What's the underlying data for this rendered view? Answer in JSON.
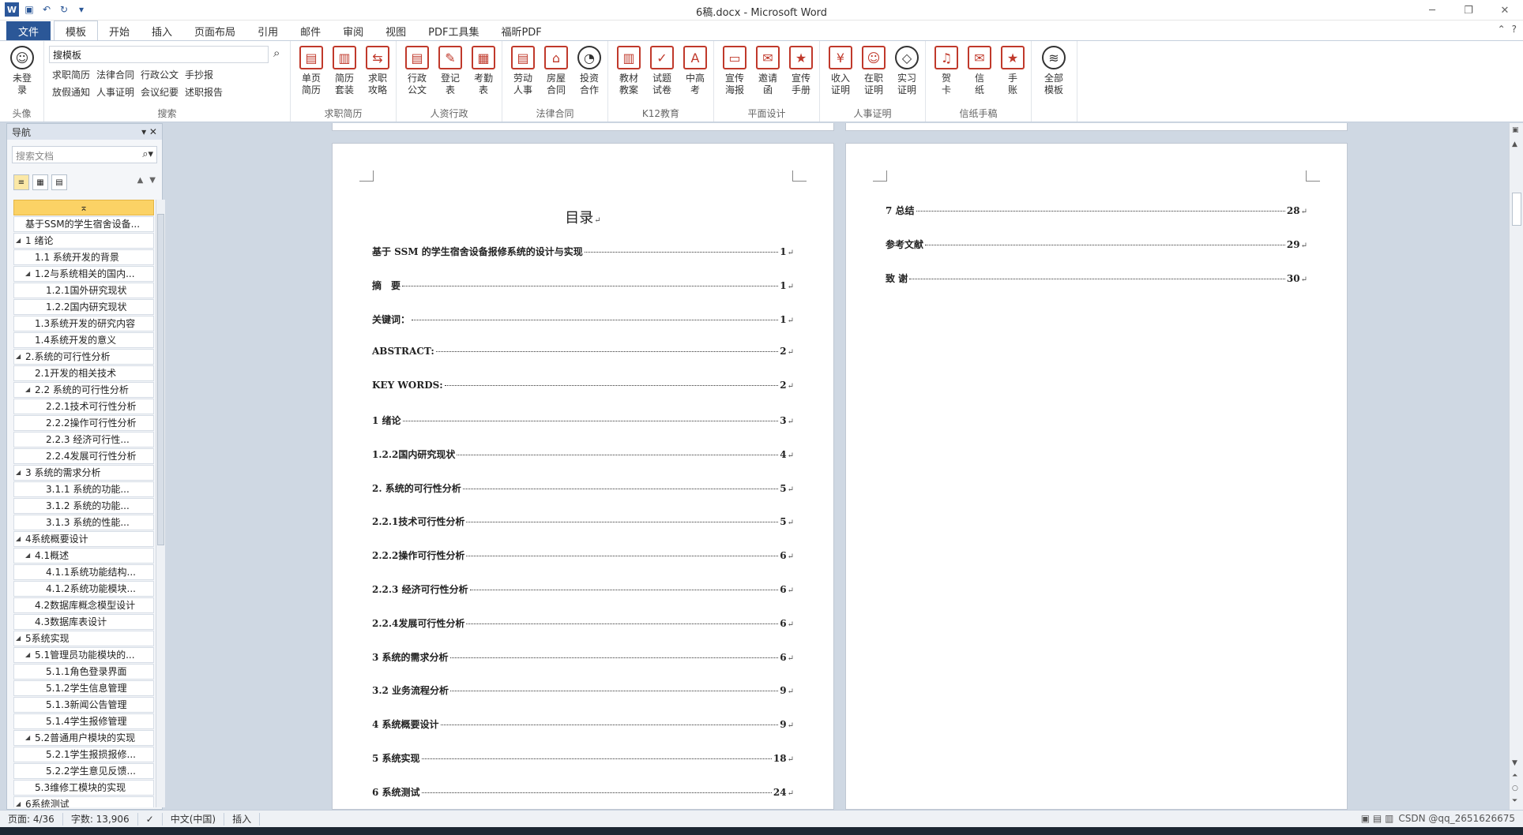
{
  "window": {
    "title": "6稿.docx - Microsoft Word"
  },
  "tabs": [
    {
      "label": "文件"
    },
    {
      "label": "模板"
    },
    {
      "label": "开始"
    },
    {
      "label": "插入"
    },
    {
      "label": "页面布局"
    },
    {
      "label": "引用"
    },
    {
      "label": "邮件"
    },
    {
      "label": "审阅"
    },
    {
      "label": "视图"
    },
    {
      "label": "PDF工具集"
    },
    {
      "label": "福昕PDF"
    }
  ],
  "ribbon": {
    "avatar": {
      "label1": "未登",
      "label2": "录",
      "group": "头像"
    },
    "search": {
      "value": "搜模板",
      "links_row1": [
        "求职简历",
        "法律合同",
        "行政公文",
        "手抄报"
      ],
      "links_row2": [
        "放假通知",
        "人事证明",
        "会议纪要",
        "述职报告"
      ],
      "group": "搜索"
    },
    "groups": [
      {
        "label": "求职简历",
        "buttons": [
          [
            "单页",
            "简历"
          ],
          [
            "简历",
            "套装"
          ],
          [
            "求职",
            "攻略"
          ]
        ]
      },
      {
        "label": "人资行政",
        "buttons": [
          [
            "行政",
            "公文"
          ],
          [
            "登记",
            "表"
          ],
          [
            "考勤",
            "表"
          ]
        ]
      },
      {
        "label": "法律合同",
        "buttons": [
          [
            "劳动",
            "人事"
          ],
          [
            "房屋",
            "合同"
          ],
          [
            "投资",
            "合作"
          ]
        ]
      },
      {
        "label": "K12教育",
        "buttons": [
          [
            "教材",
            "教案"
          ],
          [
            "试题",
            "试卷"
          ],
          [
            "中高",
            "考"
          ]
        ]
      },
      {
        "label": "平面设计",
        "buttons": [
          [
            "宣传",
            "海报"
          ],
          [
            "邀请",
            "函"
          ],
          [
            "宣传",
            "手册"
          ]
        ]
      },
      {
        "label": "人事证明",
        "buttons": [
          [
            "收入",
            "证明"
          ],
          [
            "在职",
            "证明"
          ],
          [
            "实习",
            "证明"
          ]
        ]
      },
      {
        "label": "信纸手稿",
        "buttons": [
          [
            "贺",
            "卡"
          ],
          [
            "信",
            "纸"
          ],
          [
            "手",
            "账"
          ]
        ]
      },
      {
        "label": "",
        "buttons": [
          [
            "全部",
            "模板"
          ]
        ]
      }
    ]
  },
  "nav": {
    "title": "导航",
    "search_placeholder": "搜索文档",
    "items": [
      {
        "text": "基于SSM的学生宿舍设备...",
        "level": 0
      },
      {
        "text": "1 绪论",
        "level": 0,
        "expanded": true
      },
      {
        "text": "1.1 系统开发的背景",
        "level": 1
      },
      {
        "text": "1.2与系统相关的国内...",
        "level": 1,
        "expanded": true
      },
      {
        "text": "1.2.1国外研究现状",
        "level": 2
      },
      {
        "text": "1.2.2国内研究现状",
        "level": 2
      },
      {
        "text": "1.3系统开发的研究内容",
        "level": 1
      },
      {
        "text": "1.4系统开发的意义",
        "level": 1
      },
      {
        "text": "2.系统的可行性分析",
        "level": 0,
        "expanded": true
      },
      {
        "text": "2.1开发的相关技术",
        "level": 1
      },
      {
        "text": "2.2 系统的可行性分析",
        "level": 1,
        "expanded": true
      },
      {
        "text": "2.2.1技术可行性分析",
        "level": 2
      },
      {
        "text": "2.2.2操作可行性分析",
        "level": 2
      },
      {
        "text": "2.2.3 经济可行性...",
        "level": 2
      },
      {
        "text": "2.2.4发展可行性分析",
        "level": 2
      },
      {
        "text": "3 系统的需求分析",
        "level": 0,
        "expanded": true
      },
      {
        "text": "3.1.1 系统的功能...",
        "level": 2
      },
      {
        "text": "3.1.2 系统的功能...",
        "level": 2
      },
      {
        "text": "3.1.3 系统的性能...",
        "level": 2
      },
      {
        "text": "4系统概要设计",
        "level": 0,
        "expanded": true
      },
      {
        "text": "4.1概述",
        "level": 1,
        "expanded": true
      },
      {
        "text": "4.1.1系统功能结构...",
        "level": 2
      },
      {
        "text": "4.1.2系统功能模块...",
        "level": 2
      },
      {
        "text": "4.2数据库概念模型设计",
        "level": 1
      },
      {
        "text": "4.3数据库表设计",
        "level": 1
      },
      {
        "text": "5系统实现",
        "level": 0,
        "expanded": true
      },
      {
        "text": "5.1管理员功能模块的...",
        "level": 1,
        "expanded": true
      },
      {
        "text": "5.1.1角色登录界面",
        "level": 2
      },
      {
        "text": "5.1.2学生信息管理",
        "level": 2
      },
      {
        "text": "5.1.3新闻公告管理",
        "level": 2
      },
      {
        "text": "5.1.4学生报修管理",
        "level": 2
      },
      {
        "text": "5.2普通用户模块的实现",
        "level": 1,
        "expanded": true
      },
      {
        "text": "5.2.1学生报损报修...",
        "level": 2
      },
      {
        "text": "5.2.2学生意见反馈...",
        "level": 2
      },
      {
        "text": "5.3维修工模块的实现",
        "level": 1
      },
      {
        "text": "6系统测试",
        "level": 0,
        "expanded": true
      }
    ]
  },
  "page1": {
    "heading": "目录",
    "entries": [
      {
        "label": "基于 SSM 的学生宿舍设备报修系统的设计与实现",
        "page": "1"
      },
      {
        "label": "摘　要",
        "page": "1"
      },
      {
        "label": "关键词：",
        "page": "1"
      },
      {
        "label": "ABSTRACT:",
        "page": "2"
      },
      {
        "label": "KEY WORDS:",
        "page": "2"
      },
      {
        "label": "1  绪论",
        "page": "3"
      },
      {
        "label": "1.2.2国内研究现状",
        "page": "4"
      },
      {
        "label": "2. 系统的可行性分析",
        "page": "5"
      },
      {
        "label": "2.2.1技术可行性分析",
        "page": "5"
      },
      {
        "label": "2.2.2操作可行性分析",
        "page": "6"
      },
      {
        "label": "2.2.3  经济可行性分析",
        "page": "6"
      },
      {
        "label": "2.2.4发展可行性分析",
        "page": "6"
      },
      {
        "label": "3  系统的需求分析",
        "page": "6"
      },
      {
        "label": "3.2 业务流程分析",
        "page": "9"
      },
      {
        "label": "4 系统概要设计",
        "page": "9"
      },
      {
        "label": "5 系统实现",
        "page": "18"
      },
      {
        "label": "6 系统测试",
        "page": "24"
      }
    ]
  },
  "page2": {
    "entries": [
      {
        "label": "7 总结",
        "page": "28"
      },
      {
        "label": "参考文献",
        "page": "29"
      },
      {
        "label": "致  谢",
        "page": "30"
      }
    ]
  },
  "status": {
    "page": "页面: 4/36",
    "words": "字数: 13,906",
    "language": "中文(中国)",
    "mode": "插入",
    "watermark": "CSDN @qq_2651626675"
  }
}
